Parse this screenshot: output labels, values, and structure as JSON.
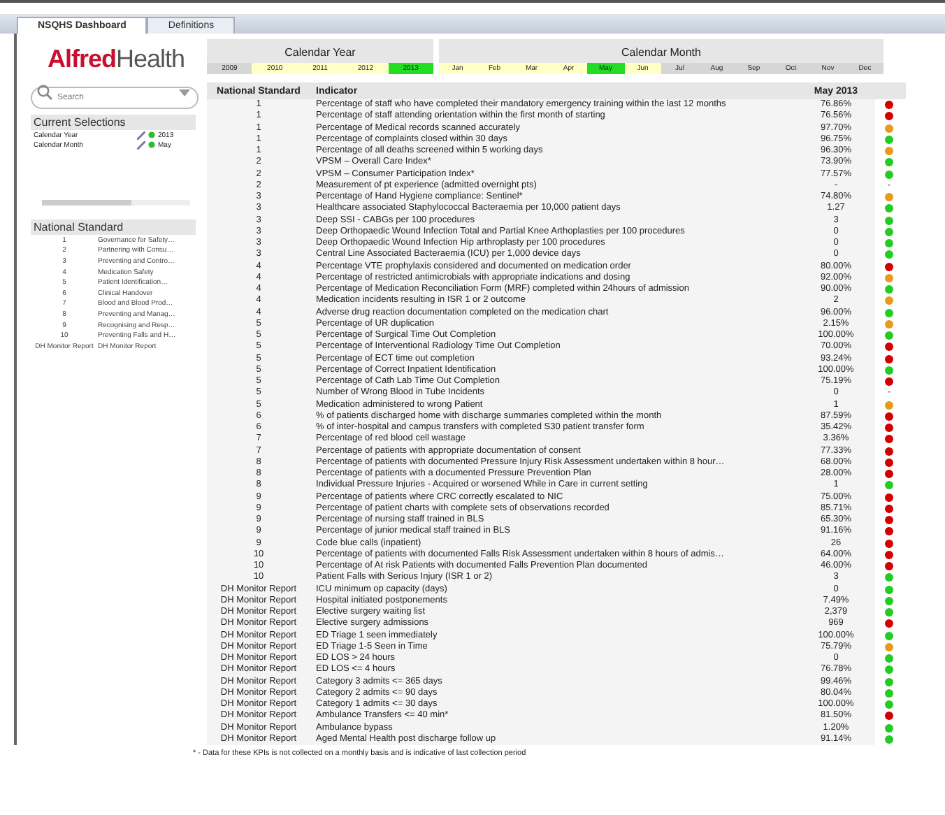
{
  "tabs": [
    {
      "label": "NSQHS Dashboard",
      "selected": true
    },
    {
      "label": "Definitions",
      "selected": false
    }
  ],
  "logo": {
    "part_1": "Alfred",
    "part_2": "Health"
  },
  "search": {
    "placeholder": "Search"
  },
  "current_selections": {
    "title": "Current Selections",
    "items": [
      {
        "field": "Calendar Year",
        "value": "2013"
      },
      {
        "field": "Calendar Month",
        "value": "May"
      }
    ]
  },
  "standards_list": {
    "title": "National Standard",
    "items": [
      {
        "number": "1",
        "name": "Governance for Safety…"
      },
      {
        "number": "2",
        "name": "Partnering with Consu…"
      },
      {
        "number": "3",
        "name": "Preventing and Contro…"
      },
      {
        "number": "4",
        "name": "Medication Safety"
      },
      {
        "number": "5",
        "name": "Patient Identification…"
      },
      {
        "number": "6",
        "name": "Clinical Handover"
      },
      {
        "number": "7",
        "name": "Blood and Blood Prod…"
      },
      {
        "number": "8",
        "name": "Preventing and Manag…"
      },
      {
        "number": "9",
        "name": "Recognising and Resp…"
      },
      {
        "number": "10",
        "name": "Preventing Falls and H…"
      },
      {
        "number": "DH Monitor Report",
        "name": "DH Monitor Report"
      }
    ]
  },
  "calendar_year": {
    "title": "Calendar Year",
    "items": [
      {
        "label": "2009",
        "selected": false,
        "available": false
      },
      {
        "label": "2010",
        "selected": false,
        "available": true
      },
      {
        "label": "2011",
        "selected": false,
        "available": true
      },
      {
        "label": "2012",
        "selected": false,
        "available": true
      },
      {
        "label": "2013",
        "selected": true,
        "available": true
      }
    ]
  },
  "calendar_month": {
    "title": "Calendar Month",
    "items": [
      {
        "label": "Jan",
        "selected": false,
        "available": true
      },
      {
        "label": "Feb",
        "selected": false,
        "available": true
      },
      {
        "label": "Mar",
        "selected": false,
        "available": true
      },
      {
        "label": "Apr",
        "selected": false,
        "available": true
      },
      {
        "label": "May",
        "selected": true,
        "available": true
      },
      {
        "label": "Jun",
        "selected": false,
        "available": true
      },
      {
        "label": "Jul",
        "selected": false,
        "available": false
      },
      {
        "label": "Aug",
        "selected": false,
        "available": false
      },
      {
        "label": "Sep",
        "selected": false,
        "available": false
      },
      {
        "label": "Oct",
        "selected": false,
        "available": false
      },
      {
        "label": "Nov",
        "selected": false,
        "available": false
      },
      {
        "label": "Dec",
        "selected": false,
        "available": false
      }
    ]
  },
  "table": {
    "columns": [
      "National Standard",
      "Indicator",
      "May 2013"
    ],
    "rows": [
      {
        "standard": "1",
        "indicator": "Percentage of staff who have completed their mandatory emergency training within the last 12 months",
        "value": "76.86%",
        "color": "#d40000"
      },
      {
        "standard": "1",
        "indicator": "Percentage of staff attending orientation within the first month of starting",
        "value": "76.56%",
        "color": "#d40000"
      },
      {
        "standard": "1",
        "indicator": "Percentage of Medical records scanned accurately",
        "value": "97.70%",
        "color": "#e89a1c"
      },
      {
        "standard": "1",
        "indicator": "Percentage of complaints closed within 30 days",
        "value": "96.75%",
        "color": "#22cc22"
      },
      {
        "standard": "1",
        "indicator": "Percentage of all deaths screened within 5 working days",
        "value": "96.30%",
        "color": "#e89a1c"
      },
      {
        "standard": "2",
        "indicator": "VPSM – Overall Care Index*",
        "value": "73.90%",
        "color": "#22cc22"
      },
      {
        "standard": "2",
        "indicator": "VPSM – Consumer Participation Index*",
        "value": "77.57%",
        "color": "#22cc22"
      },
      {
        "standard": "2",
        "indicator": "Measurement of pt experience (admitted overnight pts)",
        "value": "-",
        "status_text": "-"
      },
      {
        "standard": "3",
        "indicator": "Percentage of Hand Hygiene compliance: Sentinel*",
        "value": "74.80%",
        "color": "#e89a1c"
      },
      {
        "standard": "3",
        "indicator": "Healthcare associated Staphylococcal Bacteraemia per 10,000 patient days",
        "value": "1.27",
        "color": "#22cc22"
      },
      {
        "standard": "3",
        "indicator": "Deep SSI - CABGs per 100 procedures",
        "value": "3",
        "color": "#22cc22"
      },
      {
        "standard": "3",
        "indicator": "Deep Orthopaedic Wound Infection Total and Partial Knee Arthoplasties per 100 procedures",
        "value": "0",
        "color": "#22cc22"
      },
      {
        "standard": "3",
        "indicator": "Deep Orthopaedic Wound Infection Hip arthroplasty per 100 procedures",
        "value": "0",
        "color": "#22cc22"
      },
      {
        "standard": "3",
        "indicator": "Central Line Associated Bacteraemia (ICU) per 1,000 device days",
        "value": "0",
        "color": "#22cc22"
      },
      {
        "standard": "4",
        "indicator": "Percentage VTE prophylaxis considered and documented on medication order",
        "value": "80.00%",
        "color": "#d40000"
      },
      {
        "standard": "4",
        "indicator": "Percentage of restricted antimicrobials with appropriate indications and dosing",
        "value": "92.00%",
        "color": "#e89a1c"
      },
      {
        "standard": "4",
        "indicator": "Percentage of Medication Reconciliation Form (MRF) completed within 24hours of admission",
        "value": "90.00%",
        "color": "#22cc22"
      },
      {
        "standard": "4",
        "indicator": "Medication incidents resulting in ISR 1 or 2 outcome",
        "value": "2",
        "color": "#e89a1c"
      },
      {
        "standard": "4",
        "indicator": "Adverse drug reaction documentation completed on the medication chart",
        "value": "96.00%",
        "color": "#22cc22"
      },
      {
        "standard": "5",
        "indicator": "Percentage of UR duplication",
        "value": "2.15%",
        "color": "#e89a1c"
      },
      {
        "standard": "5",
        "indicator": "Percentage of Surgical Time Out Completion",
        "value": "100.00%",
        "color": "#22cc22"
      },
      {
        "standard": "5",
        "indicator": "Percentage of Interventional Radiology Time Out Completion",
        "value": "70.00%",
        "color": "#d40000"
      },
      {
        "standard": "5",
        "indicator": "Percentage of ECT time out completion",
        "value": "93.24%",
        "color": "#d40000"
      },
      {
        "standard": "5",
        "indicator": "Percentage of Correct Inpatient Identification",
        "value": "100.00%",
        "color": "#22cc22"
      },
      {
        "standard": "5",
        "indicator": "Percentage of Cath Lab Time Out Completion",
        "value": "75.19%",
        "color": "#d40000"
      },
      {
        "standard": "5",
        "indicator": "Number of Wrong Blood in Tube Incidents",
        "value": "0",
        "status_text": "-"
      },
      {
        "standard": "5",
        "indicator": "Medication administered to wrong Patient",
        "value": "1",
        "color": "#e89a1c"
      },
      {
        "standard": "6",
        "indicator": "% of patients discharged home with discharge summaries completed within the month",
        "value": "87.59%",
        "color": "#d40000"
      },
      {
        "standard": "6",
        "indicator": "% of inter-hospital and campus transfers with completed S30 patient transfer form",
        "value": "35.42%",
        "color": "#d40000"
      },
      {
        "standard": "7",
        "indicator": "Percentage of red blood cell wastage",
        "value": "3.36%",
        "color": "#d40000"
      },
      {
        "standard": "7",
        "indicator": "Percentage of patients with appropriate documentation of consent",
        "value": "77.33%",
        "color": "#d40000"
      },
      {
        "standard": "8",
        "indicator": "Percentage of patients with documented Pressure Injury Risk Assessment undertaken within 8 hour…",
        "value": "68.00%",
        "color": "#d40000"
      },
      {
        "standard": "8",
        "indicator": "Percentage of patients with a documented Pressure Prevention Plan",
        "value": "28.00%",
        "color": "#d40000"
      },
      {
        "standard": "8",
        "indicator": "Individual Pressure Injuries - Acquired or worsened While in Care in current setting",
        "value": "1",
        "color": "#22cc22"
      },
      {
        "standard": "9",
        "indicator": "Percentage of patients where CRC correctly escalated to NIC",
        "value": "75.00%",
        "color": "#d40000"
      },
      {
        "standard": "9",
        "indicator": "Percentage of patient charts with complete sets of observations recorded",
        "value": "85.71%",
        "color": "#d40000"
      },
      {
        "standard": "9",
        "indicator": "Percentage of nursing staff trained in BLS",
        "value": "65.30%",
        "color": "#d40000"
      },
      {
        "standard": "9",
        "indicator": "Percentage of junior medical staff trained in BLS",
        "value": "91.16%",
        "color": "#d40000"
      },
      {
        "standard": "9",
        "indicator": "Code blue calls (inpatient)",
        "value": "26",
        "color": "#d40000"
      },
      {
        "standard": "10",
        "indicator": "Percentage of patients with documented Falls Risk Assessment undertaken within 8 hours of admis…",
        "value": "64.00%",
        "color": "#d40000"
      },
      {
        "standard": "10",
        "indicator": "Percentage of At risk Patients with documented Falls Prevention Plan documented",
        "value": "46.00%",
        "color": "#d40000"
      },
      {
        "standard": "10",
        "indicator": "Patient Falls with Serious Injury (ISR 1 or 2)",
        "value": "3",
        "color": "#22cc22"
      },
      {
        "standard": "DH Monitor Report",
        "indicator": "ICU minimum op capacity (days)",
        "value": "0",
        "color": "#22cc22"
      },
      {
        "standard": "DH Monitor Report",
        "indicator": "Hospital initiated postponements",
        "value": "7.49%",
        "color": "#22cc22"
      },
      {
        "standard": "DH Monitor Report",
        "indicator": "Elective surgery waiting list",
        "value": "2,379",
        "color": "#22cc22"
      },
      {
        "standard": "DH Monitor Report",
        "indicator": "Elective surgery admissions",
        "value": "969",
        "color": "#d40000"
      },
      {
        "standard": "DH Monitor Report",
        "indicator": "ED Triage 1 seen immediately",
        "value": "100.00%",
        "color": "#22cc22"
      },
      {
        "standard": "DH Monitor Report",
        "indicator": "ED Triage 1-5 Seen in Time",
        "value": "75.79%",
        "color": "#e89a1c"
      },
      {
        "standard": "DH Monitor Report",
        "indicator": "ED LOS > 24 hours",
        "value": "0",
        "color": "#22cc22"
      },
      {
        "standard": "DH Monitor Report",
        "indicator": "ED LOS <= 4 hours",
        "value": "76.78%",
        "color": "#22cc22"
      },
      {
        "standard": "DH Monitor Report",
        "indicator": "Category 3 admits <= 365 days",
        "value": "99.46%",
        "color": "#22cc22"
      },
      {
        "standard": "DH Monitor Report",
        "indicator": "Category 2 admits <= 90 days",
        "value": "80.04%",
        "color": "#22cc22"
      },
      {
        "standard": "DH Monitor Report",
        "indicator": "Category 1 admits <= 30 days",
        "value": "100.00%",
        "color": "#22cc22"
      },
      {
        "standard": "DH Monitor Report",
        "indicator": "Ambulance Transfers <= 40 min*",
        "value": "81.50%",
        "color": "#d40000"
      },
      {
        "standard": "DH Monitor Report",
        "indicator": "Ambulance bypass",
        "value": "1.20%",
        "color": "#22cc22"
      },
      {
        "standard": "DH Monitor Report",
        "indicator": "Aged Mental Health post discharge follow up",
        "value": "91.14%",
        "color": "#22cc22"
      }
    ]
  },
  "footnote": "* - Data for these KPIs is not collected on a monthly basis and is indicative of last collection period"
}
